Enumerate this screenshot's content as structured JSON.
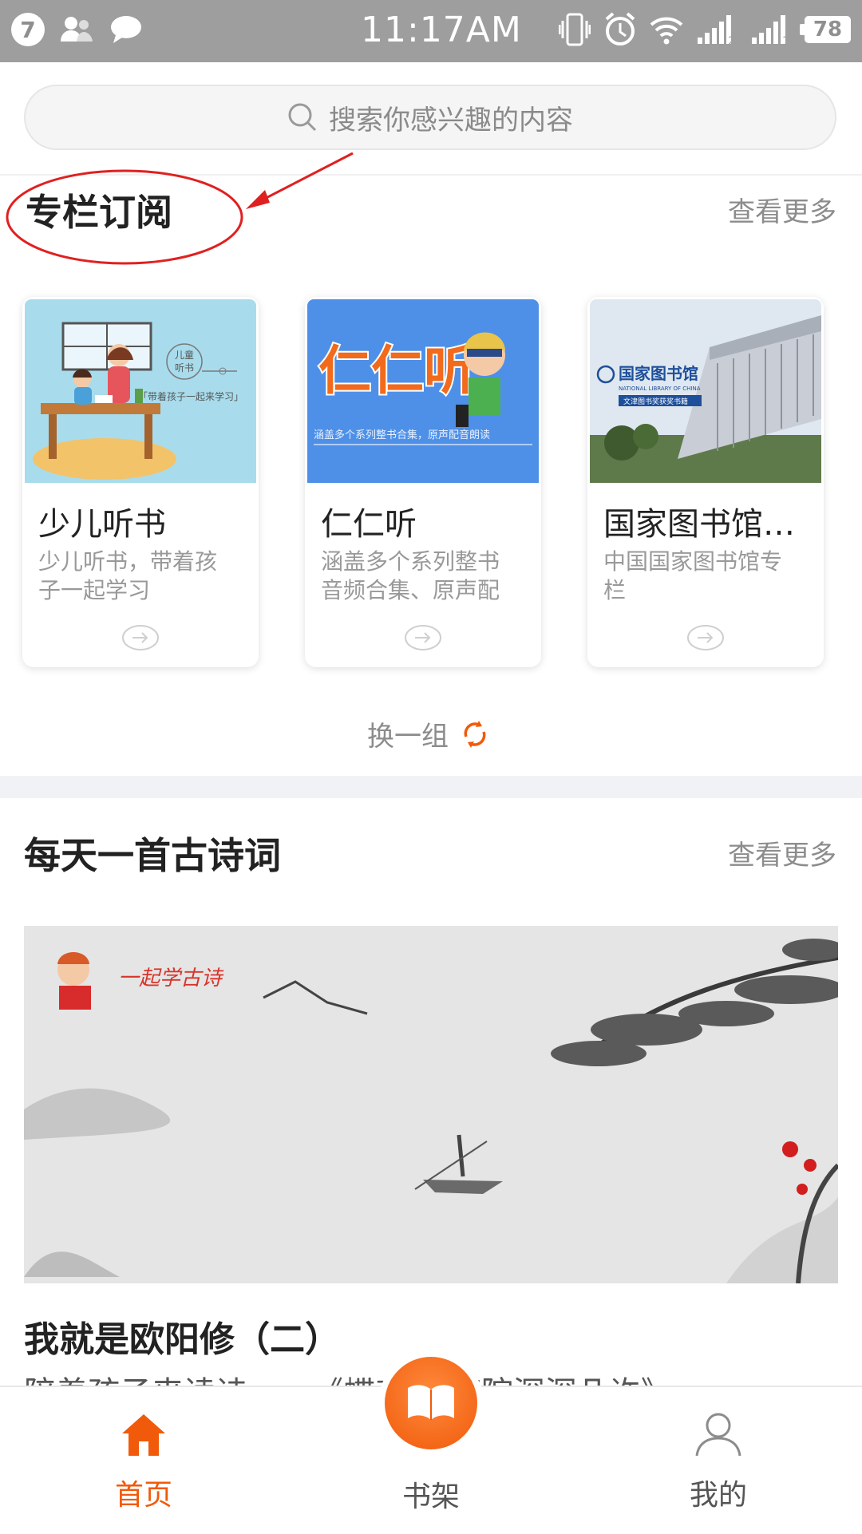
{
  "status_bar": {
    "notification_count": "7",
    "time": "11:17AM",
    "battery": "78",
    "sim1_label": "2",
    "sim2_label": "1"
  },
  "search": {
    "placeholder": "搜索你感兴趣的内容"
  },
  "column_section": {
    "title": "专栏订阅",
    "more": "查看更多",
    "cards": [
      {
        "title": "少儿听书",
        "description": "少儿听书，带着孩子一起学习",
        "thumb_texts": [
          "儿童",
          "听书",
          "「带着孩子一起来学习」"
        ]
      },
      {
        "title": "仁仁听",
        "description": "涵盖多个系列整书音频合集、原声配音朗读",
        "thumb_texts": [
          "仁仁听",
          "涵盖多个系列整书合集，原声配音朗读"
        ]
      },
      {
        "title": "国家图书馆专栏",
        "description": "中国国家图书馆专栏",
        "thumb_texts": [
          "国家图书馆",
          "NATIONAL LIBRARY OF CHINA",
          "文津图书奖获奖书籍"
        ]
      }
    ],
    "refresh_label": "换一组"
  },
  "poem_section": {
    "title": "每天一首古诗词",
    "more": "查看更多",
    "banner_caption": "一起学古诗",
    "item_title": "我就是欧阳修（二）",
    "item_subtitle": "陪着孩子来读诗——《蝶恋花·庭院深深几许》"
  },
  "tab_bar": {
    "home": "首页",
    "bookshelf": "书架",
    "mine": "我的"
  },
  "colors": {
    "accent": "#f05a0a",
    "annotation": "#e02020",
    "status_bar": "#9e9e9e"
  }
}
